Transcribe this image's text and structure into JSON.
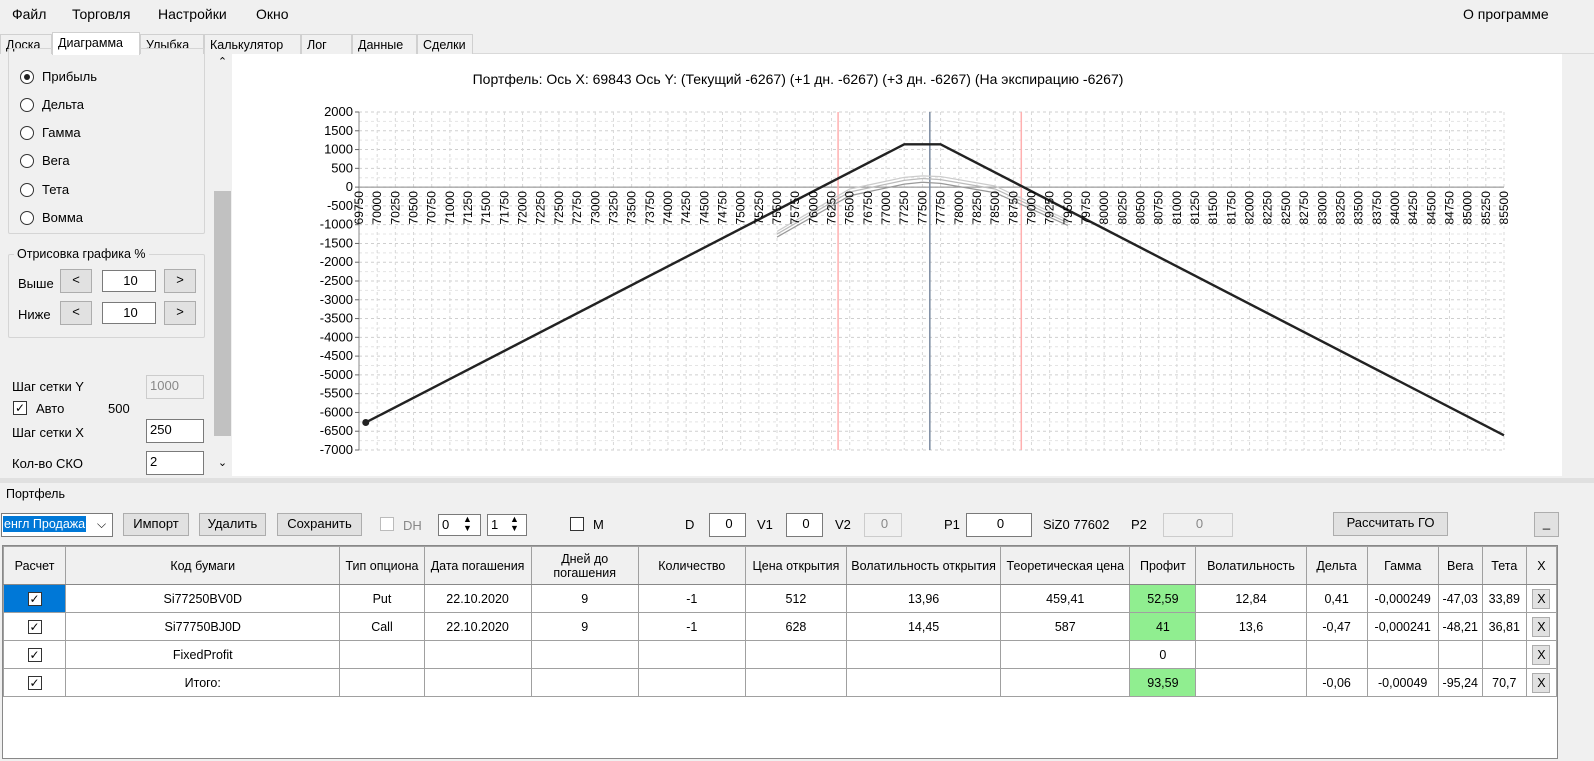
{
  "menu": {
    "file": "Файл",
    "trade": "Торговля",
    "settings": "Настройки",
    "window": "Окно",
    "about": "О программе"
  },
  "tabs": [
    "Доска",
    "Диаграмма",
    "Улыбка",
    "Калькулятор",
    "Лог",
    "Данные",
    "Сделки"
  ],
  "left": {
    "radios": [
      {
        "label": "Прибыль",
        "checked": true
      },
      {
        "label": "Дельта",
        "checked": false
      },
      {
        "label": "Гамма",
        "checked": false
      },
      {
        "label": "Вега",
        "checked": false
      },
      {
        "label": "Тета",
        "checked": false
      },
      {
        "label": "Вомма",
        "checked": false
      }
    ],
    "draw_group_title": "Отрисовка графика %",
    "above_label": "Выше",
    "above_value": "10",
    "below_label": "Ниже",
    "below_value": "10",
    "dec": "<",
    "inc": ">",
    "grid_y_label": "Шаг сетки Y",
    "grid_y_value": "1000",
    "auto_label": "Авто",
    "auto_value": "500",
    "grid_x_label": "Шаг сетки X",
    "grid_x_value": "250",
    "sko_label": "Кол-во СКО",
    "sko_value": "2"
  },
  "chart_data": {
    "type": "line",
    "title": "Портфель: Ось X:  69843 Ось Y:   (Текущий -6267)  (+1 дн. -6267)  (+3 дн. -6267)  (На экспирацию -6267)",
    "xlim": [
      69750,
      85500
    ],
    "ylim": [
      -7000,
      2000
    ],
    "x_ticks": [
      69750,
      70000,
      70250,
      70500,
      70750,
      71000,
      71250,
      71500,
      71750,
      72000,
      72250,
      72500,
      72750,
      73000,
      73250,
      73500,
      73750,
      74000,
      74250,
      74500,
      74750,
      75000,
      75250,
      75500,
      75750,
      76000,
      76250,
      76500,
      76750,
      77000,
      77250,
      77500,
      77750,
      78000,
      78250,
      78500,
      78750,
      79000,
      79250,
      79500,
      79750,
      80000,
      80250,
      80500,
      80750,
      81000,
      81250,
      81500,
      81750,
      82000,
      82250,
      82500,
      82750,
      83000,
      83250,
      83500,
      83750,
      84000,
      84250,
      84500,
      84750,
      85000,
      85250,
      85500
    ],
    "y_ticks": [
      2000,
      1500,
      1000,
      500,
      0,
      -500,
      -1000,
      -1500,
      -2000,
      -2500,
      -3000,
      -3500,
      -4000,
      -4500,
      -5000,
      -5500,
      -6000,
      -6500,
      -7000
    ],
    "grid": true,
    "vertical_lines": [
      {
        "x": 76340,
        "color": "#ffb0b0"
      },
      {
        "x": 77602,
        "color": "#7a8aa0"
      },
      {
        "x": 78860,
        "color": "#ffb0b0"
      }
    ],
    "series": [
      {
        "color": "#222222",
        "points": [
          [
            69843,
            -6267
          ],
          [
            77250,
            1140
          ],
          [
            77750,
            1140
          ],
          [
            85500,
            -6610
          ]
        ]
      },
      {
        "color": "#999999",
        "points": [
          [
            75500,
            -1330
          ],
          [
            76500,
            -230
          ],
          [
            77250,
            80
          ],
          [
            77500,
            130
          ],
          [
            77750,
            100
          ],
          [
            78500,
            -150
          ],
          [
            79500,
            -1020
          ]
        ]
      },
      {
        "color": "#bbbbbb",
        "points": [
          [
            75500,
            -1250
          ],
          [
            76500,
            -130
          ],
          [
            77250,
            180
          ],
          [
            77500,
            230
          ],
          [
            77750,
            200
          ],
          [
            78500,
            -50
          ],
          [
            79500,
            -950
          ]
        ]
      },
      {
        "color": "#cccccc",
        "points": [
          [
            75500,
            -1180
          ],
          [
            76500,
            -50
          ],
          [
            77250,
            260
          ],
          [
            77500,
            300
          ],
          [
            77750,
            280
          ],
          [
            78500,
            30
          ],
          [
            79500,
            -880
          ]
        ]
      }
    ],
    "marker": {
      "x": 69843,
      "y": -6267
    }
  },
  "portfolio": {
    "title": "Портфель",
    "combo_value": "енгл Продажа",
    "import": "Импорт",
    "delete": "Удалить",
    "save": "Сохранить",
    "dh_label": "DH",
    "spin1": "0",
    "spin2": "1",
    "m_label": "M",
    "d_label": "D",
    "d_value": "0",
    "v1_label": "V1",
    "v1_value": "0",
    "v2_label": "V2",
    "v2_value": "0",
    "p1_label": "P1",
    "p1_value": "0",
    "p1_info": "SiZ0 77602",
    "p2_label": "P2",
    "p2_value": "0",
    "calc_go": "Рассчитать ГО",
    "min_btn": "_",
    "columns": [
      "Расчет",
      "Код бумаги",
      "Тип опциона",
      "Дата погашения",
      "Дней до погашения",
      "Количество",
      "Цена открытия",
      "Волатильность открытия",
      "Теоретическая цена",
      "Профит",
      "Волатильность",
      "Дельта",
      "Гамма",
      "Вега",
      "Тета",
      "X"
    ],
    "rows": [
      [
        "Si77250BV0D",
        "Put",
        "22.10.2020",
        "9",
        "-1",
        "512",
        "13,96",
        "459,41",
        "52,59",
        "12,84",
        "0,41",
        "-0,000249",
        "-47,03",
        "33,89"
      ],
      [
        "Si77750BJ0D",
        "Call",
        "22.10.2020",
        "9",
        "-1",
        "628",
        "14,45",
        "587",
        "41",
        "13,6",
        "-0,47",
        "-0,000241",
        "-48,21",
        "36,81"
      ],
      [
        "FixedProfit",
        "",
        "",
        "",
        "",
        "",
        "",
        "",
        "0",
        "",
        "",
        "",
        "",
        ""
      ],
      [
        "Итого:",
        "",
        "",
        "",
        "",
        "",
        "",
        "",
        "93,59",
        "",
        "-0,06",
        "-0,00049",
        "-95,24",
        "70,7"
      ]
    ],
    "x_label": "X"
  }
}
